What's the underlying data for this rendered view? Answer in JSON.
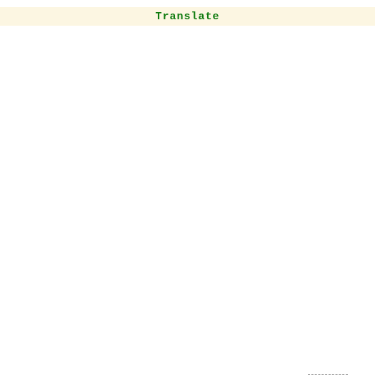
{
  "header": {
    "title": "Translate"
  }
}
